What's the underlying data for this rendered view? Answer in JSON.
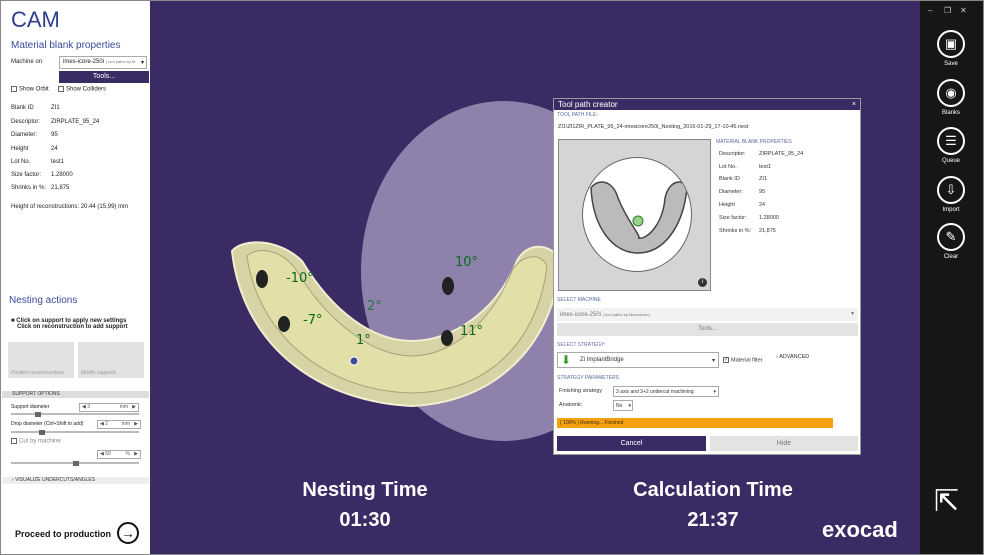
{
  "left": {
    "title": "CAM",
    "subtitle": "Material blank properties",
    "machine_label": "Machine on",
    "machine_value": "imes-icore-250i",
    "machine_note": "( tool paths by M",
    "tools_label": "Tools...",
    "show_orbit": "Show Orbit",
    "show_colliders": "Show Colliders",
    "props": [
      {
        "label": "Blank ID",
        "value": "ZI1"
      },
      {
        "label": "Descriptor:",
        "value": "ZIRPLATE_95_24"
      },
      {
        "label": "Diameter:",
        "value": "95"
      },
      {
        "label": "Height",
        "value": "24"
      },
      {
        "label": "Lot No.",
        "value": "test1"
      },
      {
        "label": "Size factor:",
        "value": "1.28000"
      },
      {
        "label": "Shrinks in %:",
        "value": "21,875"
      }
    ],
    "recon_height_label": "Height of reconstructions:",
    "recon_height_value": "20.44 (15,99)",
    "recon_height_unit": "mm",
    "nesting_title": "Nesting actions",
    "nesting_hint1": "Click on support to apply new settings",
    "nesting_hint2": "Click on reconstruction to add support",
    "tile1": "Position reconstructions",
    "tile2": "Modify supports",
    "support_options": "SUPPORT OPTIONS",
    "support_diameter_label": "Support diameter",
    "support_diameter_value": "3",
    "drop_diameter_label": "Drop diameter (Ctrl+Shift to add)",
    "drop_diameter_value": "2",
    "unit_mm": "mm",
    "cut_by_machine": "Cut by machine",
    "percent_value": "50",
    "unit_pct": "%",
    "visualize": "VISUALIZE UNDERCUTS/ANGLES",
    "proceed": "Proceed to production",
    "proceed_arrow": "→"
  },
  "viewport": {
    "angles": [
      "-10°",
      "-7°",
      "2°",
      "1°",
      "10°",
      "11°"
    ],
    "nesting_time_label": "Nesting Time",
    "nesting_time_value": "01:30",
    "calc_time_label": "Calculation Time",
    "calc_time_value": "21:37",
    "brand": "exocad"
  },
  "dialog": {
    "title": "Tool path creator",
    "close": "×",
    "tool_path_file_label": "TOOL PATH FILE:",
    "tool_path_file": "ZI1\\ZI1ZIR_PLATE_95_24-imesicore250i_Nesting_2016-01-29_17-10-45.nest",
    "blank_props_label": "MATERIAL BLANK PROPERTIES",
    "props": [
      {
        "label": "Descriptor:",
        "value": "ZIRPLATE_95_24"
      },
      {
        "label": "Lot No.",
        "value": "test1"
      },
      {
        "label": "Blank ID",
        "value": "ZI1"
      },
      {
        "label": "Diameter:",
        "value": "95"
      },
      {
        "label": "Height",
        "value": "24"
      },
      {
        "label": "Size factor:",
        "value": "1.28000"
      },
      {
        "label": "Shrinks in %:",
        "value": "21,875"
      }
    ],
    "info": "i",
    "select_machine_label": "SELECT MACHINE",
    "machine_value": "imes-icore-250i",
    "machine_note": "( tool paths by Mecadcom)",
    "tools_label": "Tools...",
    "select_strategy_label": "SELECT STRATEGY:",
    "strategy_value": "Zi ImplantBridge",
    "material_filter": "Material filter",
    "advanced": "ADVANCED",
    "strategy_params_label": "STRATEGY PARAMETERS",
    "finishing_label": "Finishing strategy",
    "finishing_value": "3 axis and 3+2 undercut machining",
    "anatomic_label": "Anatomic",
    "anatomic_value": "No",
    "progress_text": "( 100% ) Running... Finished",
    "progress_value": 1.0,
    "cancel": "Cancel",
    "hide": "Hide"
  },
  "right": {
    "buttons": [
      {
        "label": "Save",
        "icon": "save-icon",
        "glyph": "▣"
      },
      {
        "label": "Blanks",
        "icon": "blanks-icon",
        "glyph": "◉"
      },
      {
        "label": "Queue",
        "icon": "queue-icon",
        "glyph": "☰"
      },
      {
        "label": "Import",
        "icon": "import-icon",
        "glyph": "⇩"
      },
      {
        "label": "Clear",
        "icon": "clear-icon",
        "glyph": "✎"
      }
    ],
    "win_min": "–",
    "win_restore": "❐",
    "win_close": "✕",
    "expand_glyph": "⇱"
  }
}
